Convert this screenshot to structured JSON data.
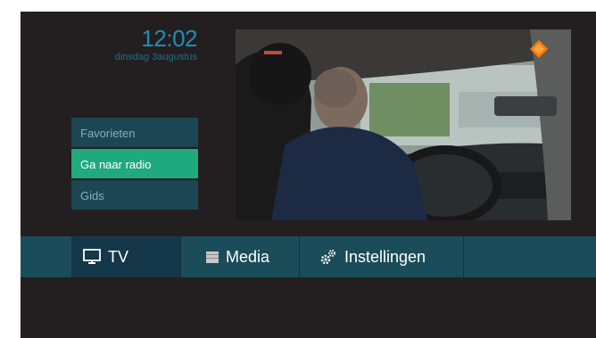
{
  "clock": {
    "time": "12:02",
    "date": "dinsdag 3augustus"
  },
  "menu": {
    "items": [
      {
        "label": "Favorieten",
        "selected": false
      },
      {
        "label": "Ga naar radio",
        "selected": true
      },
      {
        "label": "Gids",
        "selected": false
      }
    ]
  },
  "navbar": {
    "items": [
      {
        "label": "TV",
        "icon": "tv-icon"
      },
      {
        "label": "Media",
        "icon": "media-icon"
      },
      {
        "label": "Instellingen",
        "icon": "gears-icon"
      }
    ]
  },
  "colors": {
    "background": "#231f20",
    "accent_blue": "#1c8fb8",
    "selected_green": "#1fa97c",
    "navbar": "#1b4c5a"
  }
}
